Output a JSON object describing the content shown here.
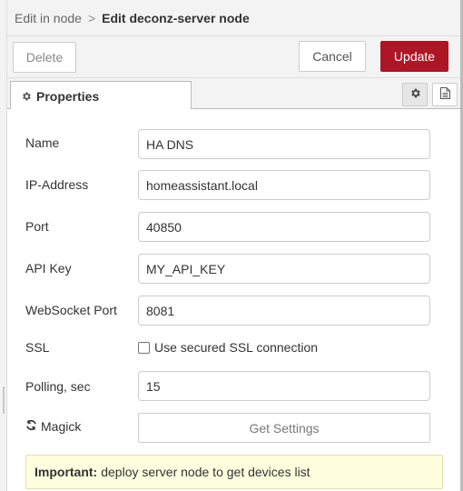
{
  "breadcrumb": {
    "parent": "Edit in node",
    "separator": ">",
    "current": "Edit deconz-server node"
  },
  "toolbar": {
    "delete_label": "Delete",
    "cancel_label": "Cancel",
    "update_label": "Update"
  },
  "tabs": {
    "properties_label": "Properties"
  },
  "form": {
    "name": {
      "label": "Name",
      "value": "HA DNS"
    },
    "ip": {
      "label": "IP-Address",
      "value": "homeassistant.local"
    },
    "port": {
      "label": "Port",
      "value": "40850"
    },
    "apikey": {
      "label": "API Key",
      "value": "MY_API_KEY"
    },
    "ws": {
      "label": "WebSocket Port",
      "value": "8081"
    },
    "ssl": {
      "label": "SSL",
      "checkbox_label": "Use secured SSL connection",
      "checked": false
    },
    "polling": {
      "label": "Polling, sec",
      "value": "15"
    },
    "magick": {
      "label": "Magick",
      "button_label": "Get Settings"
    }
  },
  "notice": {
    "strong": "Important:",
    "text": "deploy server node to get devices list"
  },
  "colors": {
    "update_button": "#ad1625",
    "notice_bg": "#ffffe0",
    "tray_bg": "#f3f3f3"
  }
}
